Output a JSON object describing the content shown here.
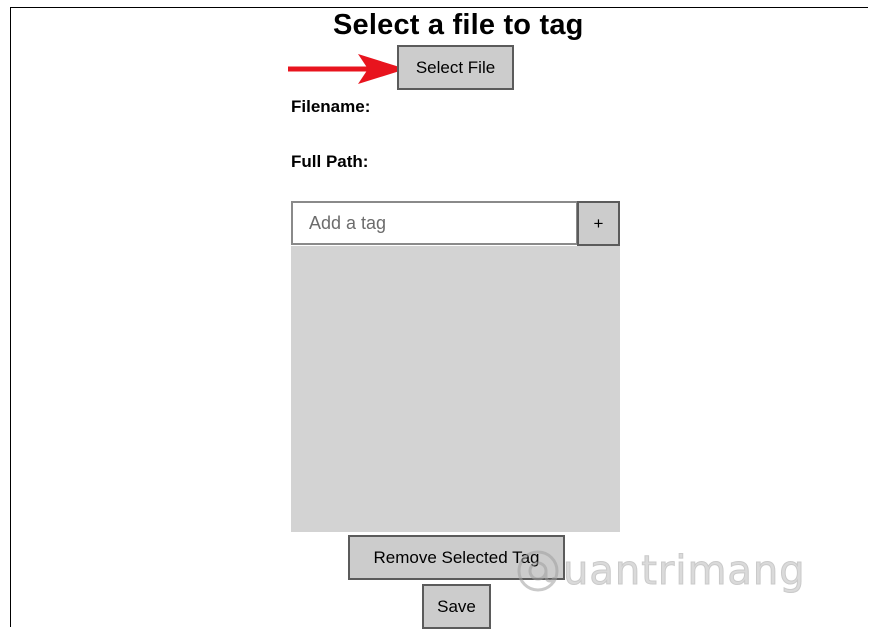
{
  "header": {
    "title": "Select a file to tag"
  },
  "file_picker": {
    "select_file_label": "Select File"
  },
  "file_info": {
    "filename_label": "Filename:",
    "full_path_label": "Full Path:"
  },
  "tag_editor": {
    "placeholder": "Add a tag",
    "value": "",
    "add_label": "+",
    "tags": []
  },
  "actions": {
    "remove_label": "Remove Selected Tag",
    "save_label": "Save"
  },
  "watermark": {
    "text": "uantrimang"
  },
  "colors": {
    "arrow": "#e8141e",
    "button_bg": "#cccccc",
    "button_border": "#5b5b5b",
    "list_bg": "#d3d3d3"
  }
}
